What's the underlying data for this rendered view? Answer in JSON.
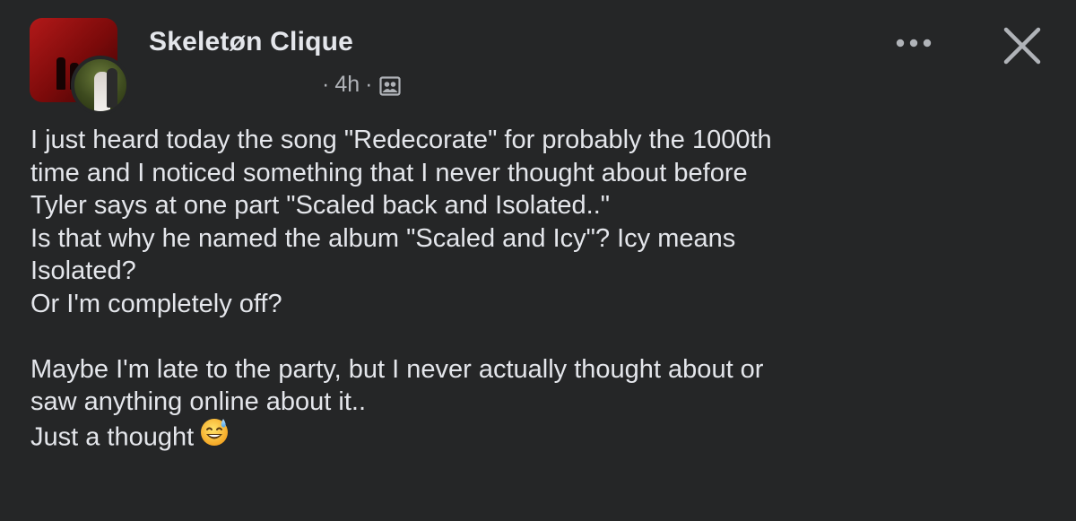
{
  "post": {
    "group_name": "Skeletøn Clique",
    "time": "4h",
    "separator": "·",
    "privacy_icon": "group-members-icon",
    "more_icon": "more-options-icon",
    "close_icon": "close-icon",
    "body_lines": [
      "I just heard today the song \"Redecorate\" for probably the 1000th",
      "time and I noticed something that I never thought about before",
      "Tyler says at one part \"Scaled back and Isolated..\"",
      "Is that why he named the album \"Scaled and Icy\"? Icy means",
      "Isolated?",
      "Or I'm completely off?",
      "",
      "Maybe I'm late to the party, but I never actually thought about or",
      "saw anything online about it..",
      "Just a thought"
    ],
    "emoji": "grinning-face-with-sweat-emoji"
  },
  "colors": {
    "background": "#252627",
    "primary_text": "#e4e6eb",
    "secondary_text": "#b0b3b8",
    "cover_red": "#b21919"
  }
}
